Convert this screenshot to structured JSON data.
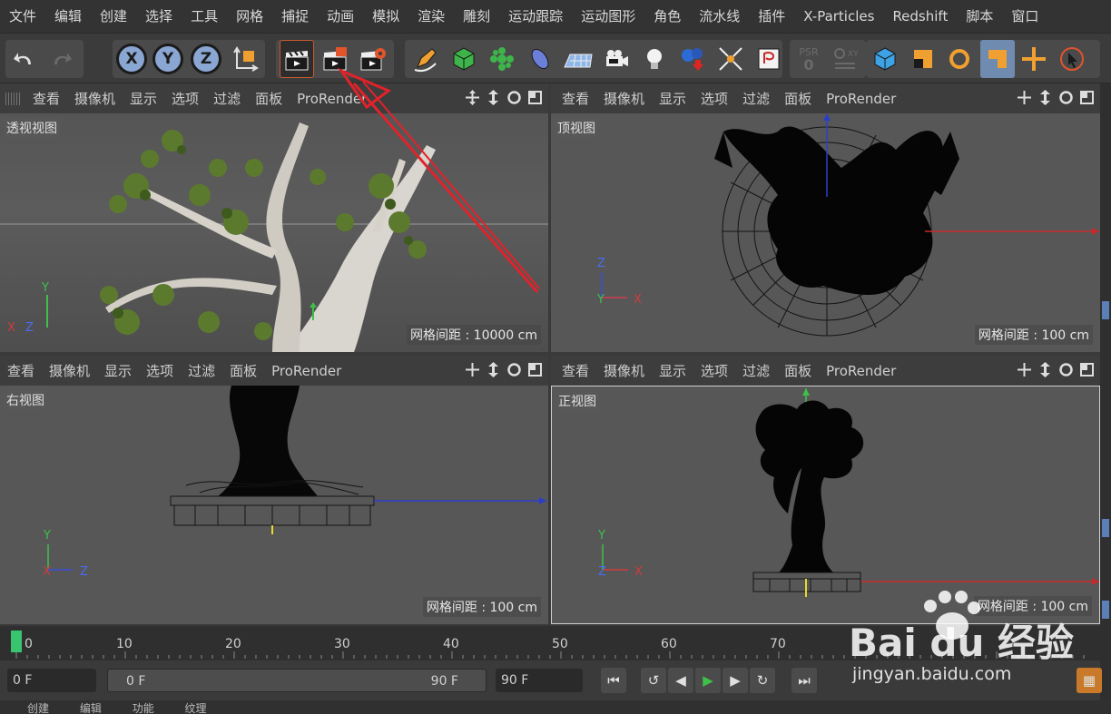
{
  "menu": [
    "文件",
    "编辑",
    "创建",
    "选择",
    "工具",
    "网格",
    "捕捉",
    "动画",
    "模拟",
    "渲染",
    "雕刻",
    "运动跟踪",
    "运动图形",
    "角色",
    "流水线",
    "插件",
    "X-Particles",
    "Redshift",
    "脚本",
    "窗口"
  ],
  "toolbar": {
    "axis_x": "X",
    "axis_y": "Y",
    "axis_z": "Z",
    "psr_label": "PSR",
    "psr_value": "0"
  },
  "viewport_menu": [
    "查看",
    "摄像机",
    "显示",
    "选项",
    "过滤",
    "面板",
    "ProRender"
  ],
  "viewports": {
    "perspective": {
      "label": "透视视图",
      "grid": "网格间距 : 10000 cm"
    },
    "top": {
      "label": "顶视图",
      "grid": "网格间距 : 100 cm"
    },
    "right": {
      "label": "右视图",
      "grid": "网格间距 : 100 cm"
    },
    "front": {
      "label": "正视图",
      "grid": "网格间距 : 100 cm"
    }
  },
  "axes": {
    "x": "X",
    "y": "Y",
    "z": "Z"
  },
  "timeline": {
    "ticks": [
      "0",
      "10",
      "20",
      "30",
      "40",
      "50",
      "60",
      "70"
    ]
  },
  "transport": {
    "current_frame": "0 F",
    "range_start": "0 F",
    "range_end": "90 F",
    "max_frame": "90 F"
  },
  "bottom": [
    "创建",
    "编辑",
    "功能",
    "纹理"
  ],
  "watermark": {
    "logo": "Bai du 经验",
    "url": "jingyan.baidu.com"
  },
  "colors": {
    "accent": "#c85a2e",
    "playhead": "#39c46f",
    "axis_x": "#d23c3c",
    "axis_y": "#3fc04a",
    "axis_z": "#3a4fd8",
    "annotation": "#e0232b"
  }
}
